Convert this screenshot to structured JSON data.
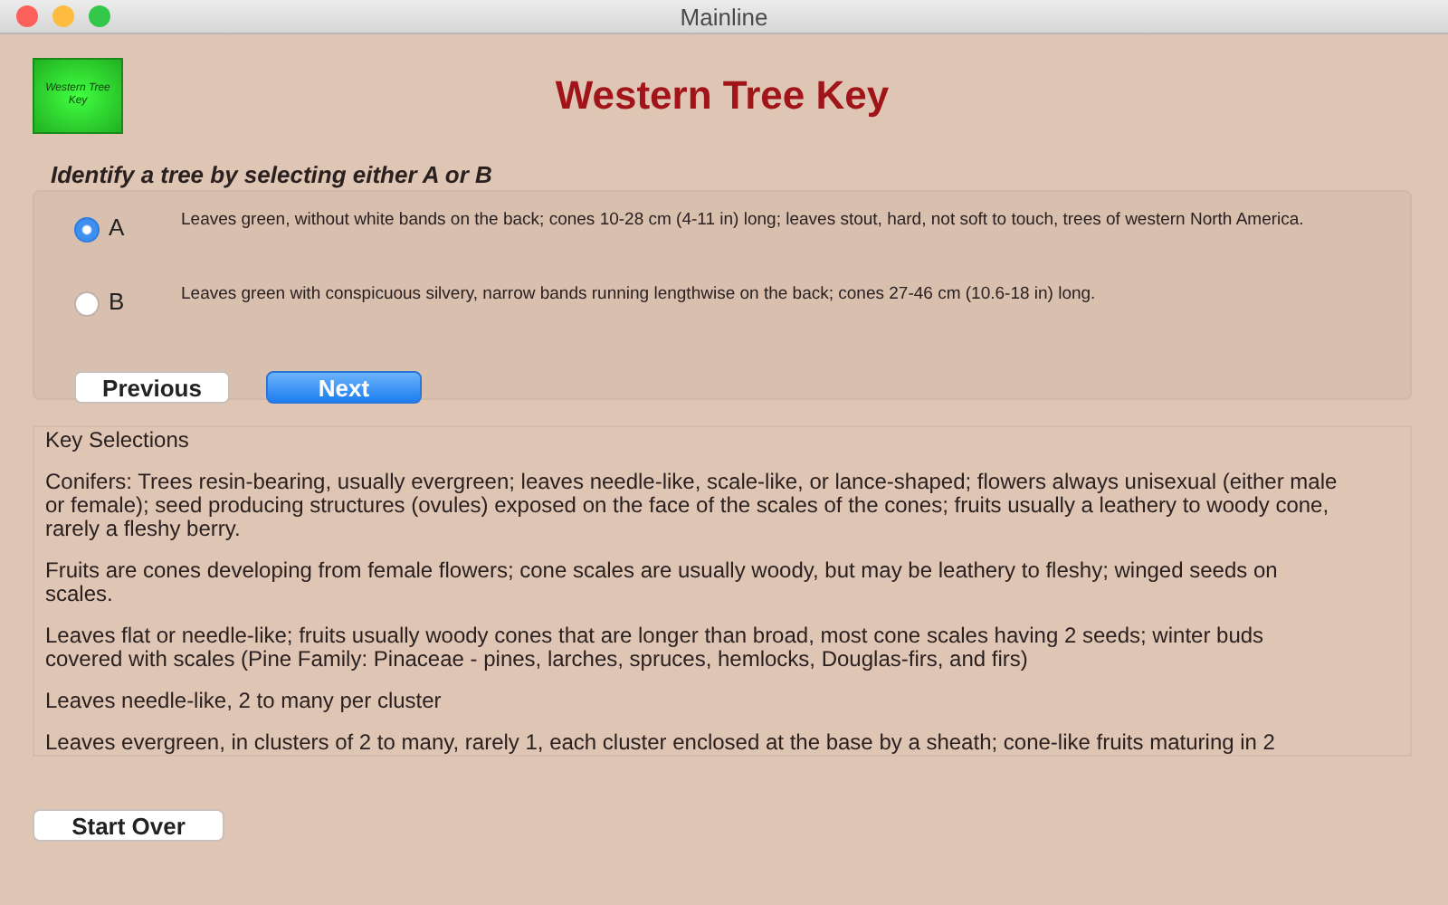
{
  "window": {
    "title": "Mainline"
  },
  "logo": {
    "text": "Western Tree Key"
  },
  "title": "Western Tree Key",
  "prompt": "Identify a tree by selecting either A or B",
  "options": [
    {
      "label": "A",
      "text": "Leaves green, without white bands on the back; cones 10-28 cm (4-11 in) long; leaves stout, hard, not soft to touch, trees of western North America.",
      "selected": true
    },
    {
      "label": "B",
      "text": "Leaves green with conspicuous silvery, narrow bands running lengthwise on the back; cones 27-46 cm (10.6-18 in) long.",
      "selected": false
    }
  ],
  "nav_buttons": [
    {
      "label": "Previous",
      "kind": "plain"
    },
    {
      "label": "Next",
      "kind": "default"
    }
  ],
  "selections": [
    "Key Selections",
    "Conifers: Trees resin-bearing, usually evergreen; leaves needle-like, scale-like, or lance-shaped; flowers always unisexual (either male or female); seed producing structures (ovules) exposed on the face of the scales of the cones; fruits usually a leathery to woody cone, rarely a fleshy berry.",
    "Fruits are cones developing from female flowers; cone scales are usually woody, but may be leathery to fleshy; winged seeds on scales.",
    "Leaves flat or needle-like; fruits usually woody cones that are longer than broad, most cone scales having 2 seeds; winter buds covered with scales (Pine Family: Pinaceae - pines, larches, spruces, hemlocks, Douglas-firs, and firs)",
    "Leaves needle-like, 2 to many per cluster",
    "Leaves evergreen, in clusters of 2 to many, rarely 1, each cluster enclosed at the base by a sheath; cone-like fruits maturing in 2"
  ],
  "start_over": "Start Over"
}
